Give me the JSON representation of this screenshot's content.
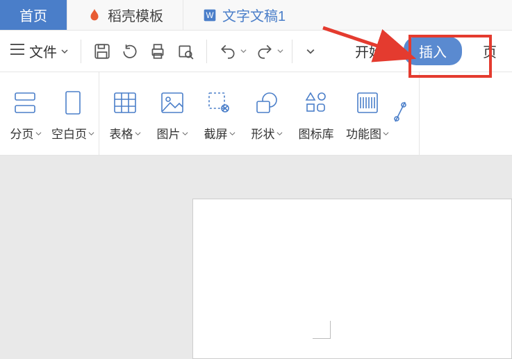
{
  "tabs": {
    "home": "首页",
    "template": "稻壳模板",
    "doc": "文字文稿1"
  },
  "quick": {
    "file": "文件"
  },
  "menu": {
    "start": "开始",
    "insert": "插入",
    "partial": "页"
  },
  "ribbon": {
    "page_break": "分页",
    "blank_page": "空白页",
    "table": "表格",
    "picture": "图片",
    "screenshot": "截屏",
    "shapes": "形状",
    "icon_lib": "图标库",
    "smart_art": "功能图"
  },
  "colors": {
    "accent": "#4a7ec9",
    "highlight": "#e43b2f"
  }
}
